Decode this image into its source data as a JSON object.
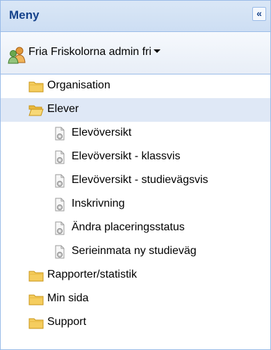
{
  "menu": {
    "title": "Meny",
    "collapse_glyph": "«",
    "user": {
      "label": "Fria Friskolorna admin fri",
      "icon": "users-icon"
    },
    "tree": [
      {
        "label": "Organisation",
        "level": 0,
        "icon": "folder-icon",
        "expanded": false
      },
      {
        "label": "Elever",
        "level": 0,
        "icon": "folder-open-icon",
        "expanded": true,
        "selected": true
      },
      {
        "label": "Elevöversikt",
        "level": 1,
        "icon": "page-gear-icon"
      },
      {
        "label": "Elevöversikt - klassvis",
        "level": 1,
        "icon": "page-gear-icon"
      },
      {
        "label": "Elevöversikt - studievägsvis",
        "level": 1,
        "icon": "page-gear-icon"
      },
      {
        "label": "Inskrivning",
        "level": 1,
        "icon": "page-gear-icon"
      },
      {
        "label": "Ändra placeringsstatus",
        "level": 1,
        "icon": "page-gear-icon"
      },
      {
        "label": "Serieinmata ny studieväg",
        "level": 1,
        "icon": "page-gear-icon"
      },
      {
        "label": "Rapporter/statistik",
        "level": 0,
        "icon": "folder-icon",
        "expanded": false
      },
      {
        "label": "Min sida",
        "level": 0,
        "icon": "folder-icon",
        "expanded": false
      },
      {
        "label": "Support",
        "level": 0,
        "icon": "folder-icon",
        "expanded": false
      }
    ]
  }
}
